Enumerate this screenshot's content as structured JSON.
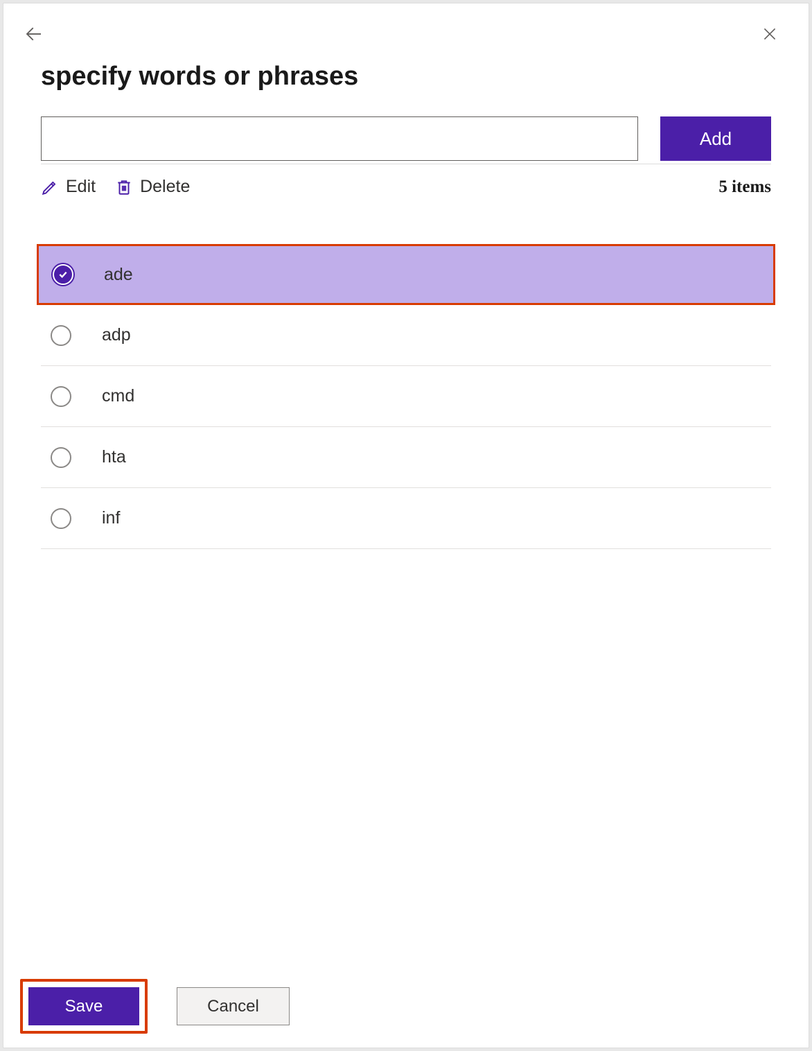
{
  "header": {
    "title": "specify words or phrases"
  },
  "input": {
    "value": "",
    "add_label": "Add"
  },
  "toolbar": {
    "edit_label": "Edit",
    "delete_label": "Delete",
    "items_count": "5 items"
  },
  "list": {
    "items": [
      {
        "label": "ade",
        "selected": true
      },
      {
        "label": "adp",
        "selected": false
      },
      {
        "label": "cmd",
        "selected": false
      },
      {
        "label": "hta",
        "selected": false
      },
      {
        "label": "inf",
        "selected": false
      }
    ]
  },
  "footer": {
    "save_label": "Save",
    "cancel_label": "Cancel"
  },
  "colors": {
    "primary": "#4b1fa8",
    "highlight_border": "#d83b01",
    "selected_bg": "#c0aeea"
  }
}
